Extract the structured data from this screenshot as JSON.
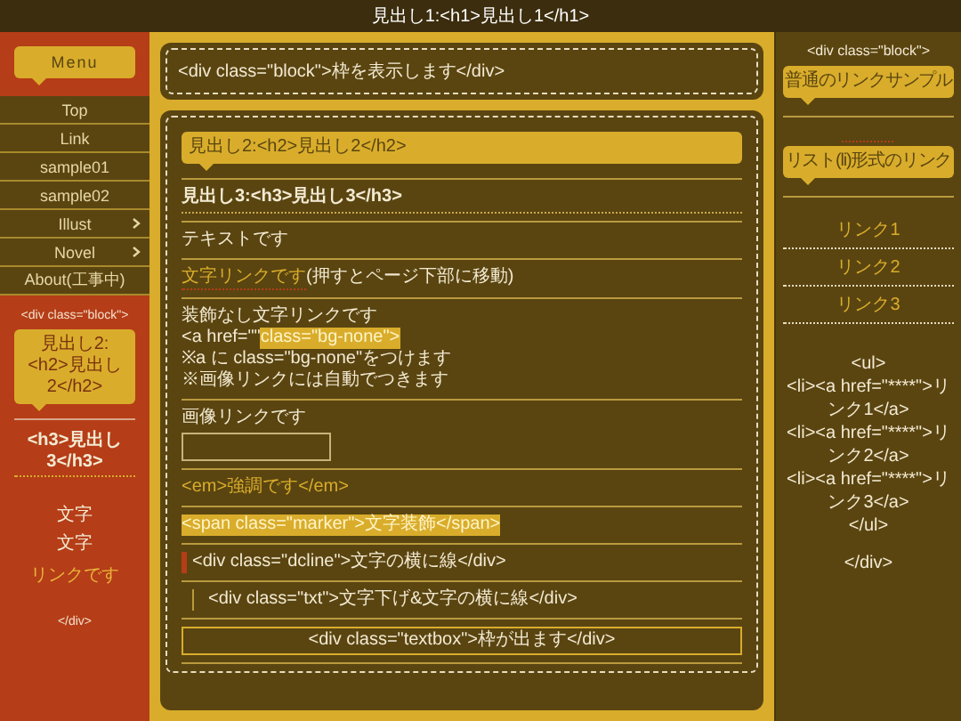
{
  "header": {
    "title": "見出し1:<h1>見出し1</h1>"
  },
  "left": {
    "menu_title": "Menu",
    "menu": [
      {
        "label": "Top",
        "has_submenu": false
      },
      {
        "label": "Link",
        "has_submenu": false
      },
      {
        "label": "sample01",
        "has_submenu": false
      },
      {
        "label": "sample02",
        "has_submenu": false
      },
      {
        "label": "Illust",
        "has_submenu": true
      },
      {
        "label": "Novel",
        "has_submenu": true
      },
      {
        "label": "About(工事中)",
        "has_submenu": false
      }
    ],
    "block": {
      "open": "<div class=\"block\">",
      "h2": "見出し2:<h2>見出し2</h2>",
      "h3": "<h3>見出し3</h3>",
      "lines": [
        {
          "kind": "text",
          "text": "文字"
        },
        {
          "kind": "text",
          "text": "文字"
        },
        {
          "kind": "link",
          "text": "リンクです"
        }
      ],
      "close": "</div>"
    }
  },
  "main": {
    "notice": "<div class=\"block\">枠を表示します</div>",
    "items": [
      {
        "kind": "h2",
        "text": "見出し2:<h2>見出し2</h2>"
      },
      {
        "kind": "h3",
        "text": "見出し3:<h3>見出し3</h3>"
      },
      {
        "kind": "text",
        "text": "テキストです"
      },
      {
        "kind": "link",
        "link": "文字リンクです",
        "text": "(押すとページ下部に移動)"
      },
      {
        "kind": "lines",
        "lines": [
          {
            "text": "装飾なし文字リンクです"
          },
          {
            "text": "<a  href=\"\" ",
            "marker": "class=\"bg-none\">"
          },
          {
            "text": "※a に class=\"bg-none\"をつけます"
          },
          {
            "text": "※画像リンクには自動でつきます"
          }
        ]
      },
      {
        "kind": "image_link",
        "text": "画像リンクです"
      },
      {
        "kind": "em",
        "text": "<em>強調です</em>"
      },
      {
        "kind": "marker",
        "text": "<span class=\"marker\">文字装飾</span>"
      },
      {
        "kind": "dcline",
        "text": "<div class=\"dcline\">文字の横に線</div>"
      },
      {
        "kind": "txt",
        "text": "<div class=\"txt\">文字下げ&文字の横に線</div>"
      },
      {
        "kind": "textbox",
        "text": "<div class=\"textbox\">枠が出ます</div>"
      }
    ]
  },
  "right": {
    "open": "<div class=\"block\">",
    "link_sample": "普通のリンクサンプル",
    "list_title": "リスト(li)形式のリンク",
    "links": [
      "リンク1",
      "リンク2",
      "リンク3"
    ],
    "code": [
      "<ul>",
      "<li><a href=\"****\">リンク1</a>",
      "<li><a href=\"****\">リンク2</a>",
      "<li><a href=\"****\">リンク3</a>",
      "</ul>"
    ],
    "close": "</div>"
  }
}
